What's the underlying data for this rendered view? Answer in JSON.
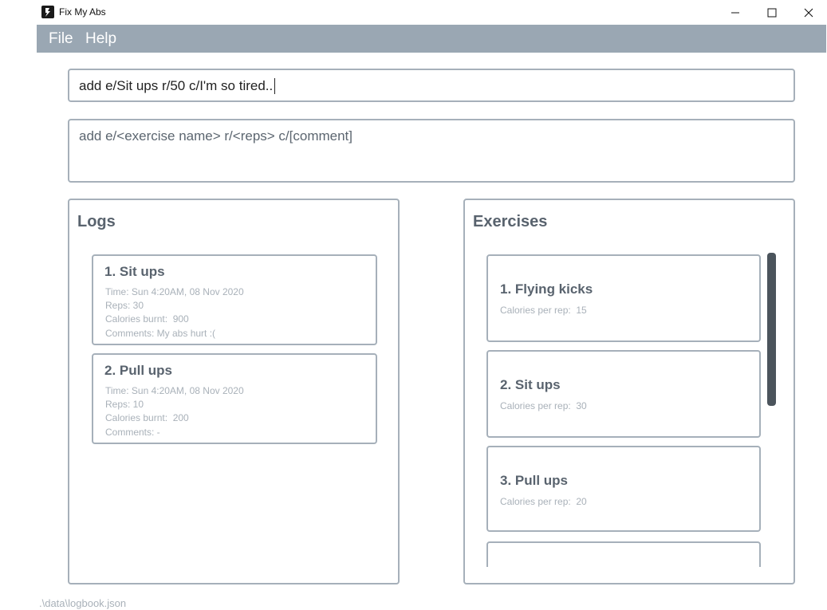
{
  "window": {
    "title": "Fix My Abs",
    "icon": "app-logo-icon"
  },
  "menu": {
    "file": "File",
    "help": "Help"
  },
  "command": {
    "value": "add e/Sit ups r/50 c/I'm so tired.."
  },
  "result": {
    "text": "add e/<exercise name> r/<reps> c/[comment]"
  },
  "logs": {
    "title": "Logs",
    "items": [
      {
        "index_name": "1.  Sit ups",
        "time": "Time: Sun 4:20AM, 08 Nov 2020",
        "reps": "Reps: 30",
        "calories": "Calories burnt:  900",
        "comments": "Comments: My abs hurt :("
      },
      {
        "index_name": "2.  Pull ups",
        "time": "Time: Sun 4:20AM, 08 Nov 2020",
        "reps": "Reps: 10",
        "calories": "Calories burnt:  200",
        "comments": "Comments: -"
      }
    ]
  },
  "exercises": {
    "title": "Exercises",
    "items": [
      {
        "index_name": "1.  Flying kicks",
        "calories": "Calories per rep:  15"
      },
      {
        "index_name": "2.  Sit ups",
        "calories": "Calories per rep:  30"
      },
      {
        "index_name": "3.  Pull ups",
        "calories": "Calories per rep:  20"
      }
    ]
  },
  "status": {
    "file_path": ".\\data\\logbook.json"
  },
  "colors": {
    "menu_bar": "#9aa7b3",
    "border": "#a6b0ba",
    "scrollbar": "#4b545c"
  }
}
